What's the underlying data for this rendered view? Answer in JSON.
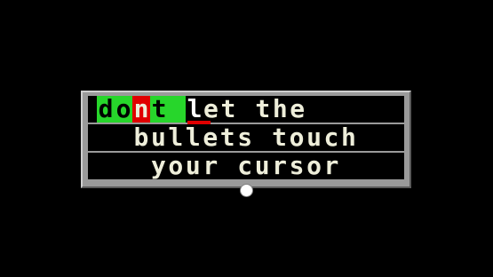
{
  "game": {
    "lines": [
      "don't let the",
      "bullets touch",
      "your cursor"
    ],
    "first_line": {
      "typed": [
        "d",
        "o"
      ],
      "error": "n",
      "typed_after": [
        "t"
      ],
      "current": "l",
      "rest": "et the"
    },
    "second_line": "bullets touch",
    "third_line": "your cursor"
  },
  "colors": {
    "background": "#000000",
    "panel": "#9a9a9a",
    "text": "#eeeeda",
    "typed_highlight": "#27d62b",
    "error_highlight": "#e00000",
    "caret": "#e00000",
    "cursor": "#ffffff"
  },
  "icons": {
    "cursor": "mouse-cursor-dot-icon"
  }
}
